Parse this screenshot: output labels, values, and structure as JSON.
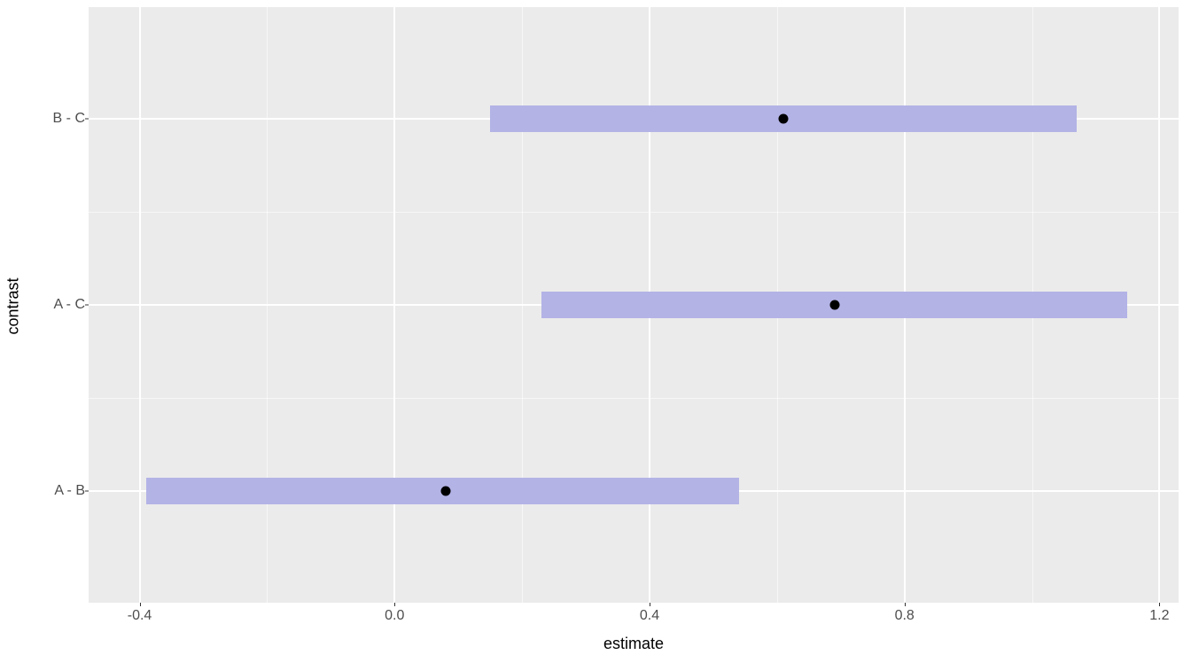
{
  "chart_data": {
    "type": "interval",
    "xlabel": "estimate",
    "ylabel": "contrast",
    "x_ticks": [
      -0.4,
      0.0,
      0.4,
      0.8,
      1.2
    ],
    "x_minor_ticks": [
      -0.2,
      0.2,
      0.6,
      1.0
    ],
    "xlim": [
      -0.48,
      1.23
    ],
    "categories": [
      "A - B",
      "A - C",
      "B - C"
    ],
    "series": [
      {
        "name": "A - B",
        "estimate": 0.08,
        "low": -0.39,
        "high": 0.54
      },
      {
        "name": "A - C",
        "estimate": 0.69,
        "low": 0.23,
        "high": 1.15
      },
      {
        "name": "B - C",
        "estimate": 0.61,
        "low": 0.15,
        "high": 1.07
      }
    ],
    "bar_color": "#b3b3e6",
    "point_color": "#000000",
    "panel_bg": "#ebebeb"
  },
  "axis": {
    "x_title": "estimate",
    "y_title": "contrast"
  }
}
